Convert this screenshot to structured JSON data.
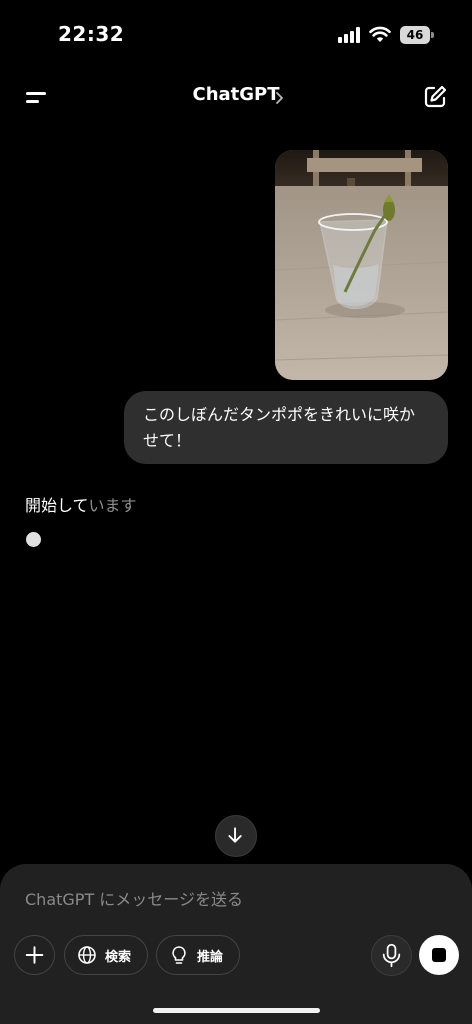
{
  "status_bar": {
    "time": "22:32",
    "battery": "46"
  },
  "header": {
    "title": "ChatGPT"
  },
  "conversation": {
    "user_message": "このしぼんだタンポポをきれいに咲かせて！",
    "assistant_status_main": "開始して",
    "assistant_status_fading": "います"
  },
  "composer": {
    "placeholder": "ChatGPT にメッセージを送る",
    "search_label": "検索",
    "reason_label": "推論"
  },
  "icons": {
    "menu": "menu-icon",
    "chevron": "chevron-right-icon",
    "edit": "edit-icon",
    "scroll_down": "arrow-down-icon",
    "plus": "plus-icon",
    "globe": "globe-icon",
    "bulb": "lightbulb-icon",
    "mic": "microphone-icon",
    "stop": "stop-icon"
  }
}
